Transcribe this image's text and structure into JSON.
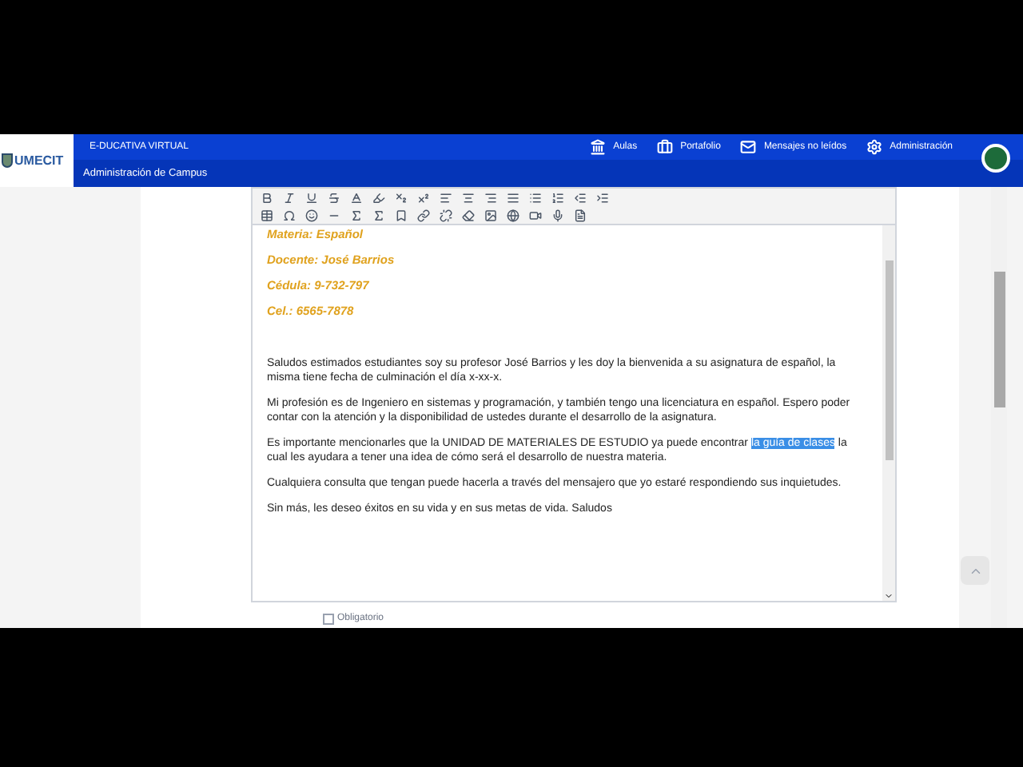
{
  "header": {
    "logo_text": "UMECIT",
    "brand": "E-DUCATIVA VIRTUAL",
    "subtitle": "Administración de Campus",
    "nav": [
      {
        "kind": "classroom",
        "label": "Aulas"
      },
      {
        "kind": "portfolio",
        "label": "Portafolio"
      },
      {
        "kind": "messages",
        "label": "Mensajes no leídos"
      },
      {
        "kind": "settings",
        "label": "Administración"
      }
    ]
  },
  "editor": {
    "content": [
      {
        "kind": "heading",
        "text": "Materia: Español"
      },
      {
        "kind": "heading",
        "text": "Docente: José Barrios"
      },
      {
        "kind": "heading",
        "text": "Cédula: 9-732-797"
      },
      {
        "kind": "heading",
        "text": "Cel.: 6565-7878"
      },
      {
        "kind": "blank"
      },
      {
        "kind": "paragraph",
        "text": "Saludos estimados estudiantes soy su profesor José Barrios y les doy la bienvenida a su asignatura de español, la misma tiene fecha de culminación el día x-xx-x."
      },
      {
        "kind": "paragraph",
        "text": "Mi profesión es de Ingeniero en sistemas y programación, y también tengo una licenciatura en español. Espero poder contar con la atención y la disponibilidad de ustedes durante el desarrollo de la asignatura."
      },
      {
        "kind": "selection",
        "before": "Es importante mencionarles que la UNIDAD DE MATERIALES DE ESTUDIO ya puede encontrar ",
        "selected": "la guía de clases",
        "after": " la cual les ayudara a tener una idea de cómo será el desarrollo de nuestra materia."
      },
      {
        "kind": "paragraph",
        "text": "Cualquiera consulta que tengan puede hacerla a través del mensajero que yo estaré respondiendo sus inquietudes."
      },
      {
        "kind": "paragraph",
        "text": "Sin más, les deseo éxitos en su vida y en sus metas de vida. Saludos"
      }
    ]
  },
  "required": {
    "label": "Obligatorio",
    "checked": false
  }
}
